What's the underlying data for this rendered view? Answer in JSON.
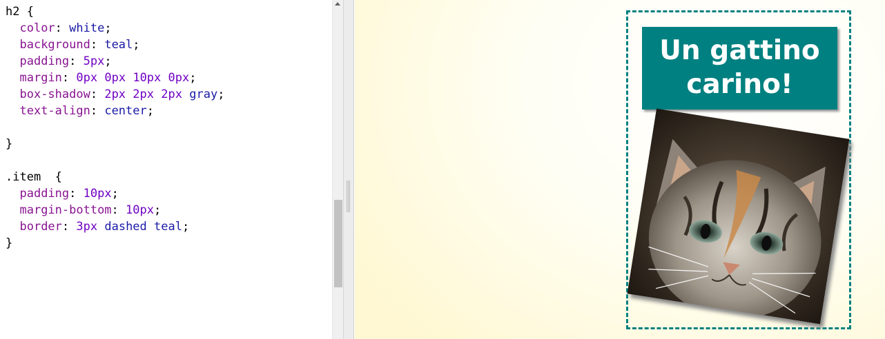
{
  "editor": {
    "lines": [
      [
        {
          "t": "h2 {",
          "c": "plain"
        }
      ],
      [
        {
          "t": "  ",
          "c": "plain"
        },
        {
          "t": "color",
          "c": "prop"
        },
        {
          "t": ": ",
          "c": "plain"
        },
        {
          "t": "white",
          "c": "val"
        },
        {
          "t": ";",
          "c": "plain"
        }
      ],
      [
        {
          "t": "  ",
          "c": "plain"
        },
        {
          "t": "background",
          "c": "prop"
        },
        {
          "t": ": ",
          "c": "plain"
        },
        {
          "t": "teal",
          "c": "val"
        },
        {
          "t": ";",
          "c": "plain"
        }
      ],
      [
        {
          "t": "  ",
          "c": "plain"
        },
        {
          "t": "padding",
          "c": "prop"
        },
        {
          "t": ": ",
          "c": "plain"
        },
        {
          "t": "5px",
          "c": "num"
        },
        {
          "t": ";",
          "c": "plain"
        }
      ],
      [
        {
          "t": "  ",
          "c": "plain"
        },
        {
          "t": "margin",
          "c": "prop"
        },
        {
          "t": ": ",
          "c": "plain"
        },
        {
          "t": "0px",
          "c": "num"
        },
        {
          "t": " ",
          "c": "plain"
        },
        {
          "t": "0px",
          "c": "num"
        },
        {
          "t": " ",
          "c": "plain"
        },
        {
          "t": "10px",
          "c": "num"
        },
        {
          "t": " ",
          "c": "plain"
        },
        {
          "t": "0px",
          "c": "num"
        },
        {
          "t": ";",
          "c": "plain"
        }
      ],
      [
        {
          "t": "  ",
          "c": "plain"
        },
        {
          "t": "box-shadow",
          "c": "prop"
        },
        {
          "t": ": ",
          "c": "plain"
        },
        {
          "t": "2px",
          "c": "num"
        },
        {
          "t": " ",
          "c": "plain"
        },
        {
          "t": "2px",
          "c": "num"
        },
        {
          "t": " ",
          "c": "plain"
        },
        {
          "t": "2px",
          "c": "num"
        },
        {
          "t": " ",
          "c": "plain"
        },
        {
          "t": "gray",
          "c": "val"
        },
        {
          "t": ";",
          "c": "plain"
        }
      ],
      [
        {
          "t": "  ",
          "c": "plain"
        },
        {
          "t": "text-align",
          "c": "prop"
        },
        {
          "t": ": ",
          "c": "plain"
        },
        {
          "t": "center",
          "c": "val"
        },
        {
          "t": ";",
          "c": "plain"
        }
      ],
      [
        {
          "t": "",
          "c": "plain"
        }
      ],
      [
        {
          "t": "}",
          "c": "plain"
        }
      ],
      [
        {
          "t": "",
          "c": "plain"
        }
      ],
      [
        {
          "t": ".item  {",
          "c": "plain"
        }
      ],
      [
        {
          "t": "  ",
          "c": "plain"
        },
        {
          "t": "padding",
          "c": "prop"
        },
        {
          "t": ": ",
          "c": "plain"
        },
        {
          "t": "10px",
          "c": "num"
        },
        {
          "t": ";",
          "c": "plain"
        }
      ],
      [
        {
          "t": "  ",
          "c": "plain"
        },
        {
          "t": "margin-bottom",
          "c": "prop"
        },
        {
          "t": ": ",
          "c": "plain"
        },
        {
          "t": "10px",
          "c": "num"
        },
        {
          "t": ";",
          "c": "plain"
        }
      ],
      [
        {
          "t": "  ",
          "c": "plain"
        },
        {
          "t": "border",
          "c": "prop"
        },
        {
          "t": ": ",
          "c": "plain"
        },
        {
          "t": "3px",
          "c": "num"
        },
        {
          "t": " ",
          "c": "plain"
        },
        {
          "t": "dashed",
          "c": "val"
        },
        {
          "t": " ",
          "c": "plain"
        },
        {
          "t": "teal",
          "c": "val"
        },
        {
          "t": ";",
          "c": "plain"
        }
      ],
      [
        {
          "t": "}",
          "c": "plain"
        }
      ]
    ],
    "syntax_colors": {
      "property": "#881391",
      "keyword_value": "#1a1aa6",
      "number": "#6f00c2",
      "plain": "#000000"
    }
  },
  "scrollbar": {
    "up_arrow_icon": "triangle-up-icon"
  },
  "preview": {
    "heading_line1": "Un gattino",
    "heading_line2": "carino!",
    "image_icon": "kitten-photo",
    "accent_color": "#008080"
  }
}
